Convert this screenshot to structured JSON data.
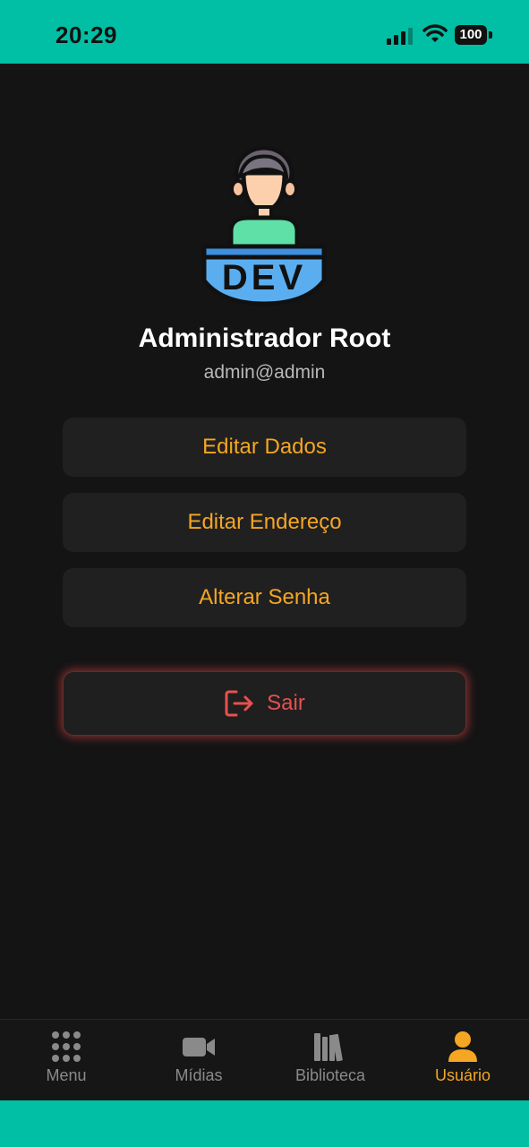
{
  "status_bar": {
    "time": "20:29",
    "battery": "100",
    "color": "#00BFA5"
  },
  "profile": {
    "avatar_label": "DEV",
    "name": "Administrador Root",
    "email": "admin@admin"
  },
  "actions": {
    "edit_data": "Editar Dados",
    "edit_address": "Editar Endereço",
    "change_password": "Alterar Senha",
    "logout": "Sair",
    "logout_icon": "logout-icon"
  },
  "tab_bar": {
    "items": [
      {
        "label": "Menu",
        "icon": "grid-icon",
        "active": false
      },
      {
        "label": "Mídias",
        "icon": "video-camera-icon",
        "active": false
      },
      {
        "label": "Biblioteca",
        "icon": "library-icon",
        "active": false
      },
      {
        "label": "Usuário",
        "icon": "user-icon",
        "active": true
      }
    ],
    "active_color": "#F5A623",
    "inactive_color": "#8a8a8a"
  },
  "colors": {
    "accent": "#F5A623",
    "danger": "#E8504F",
    "background": "#141414"
  }
}
